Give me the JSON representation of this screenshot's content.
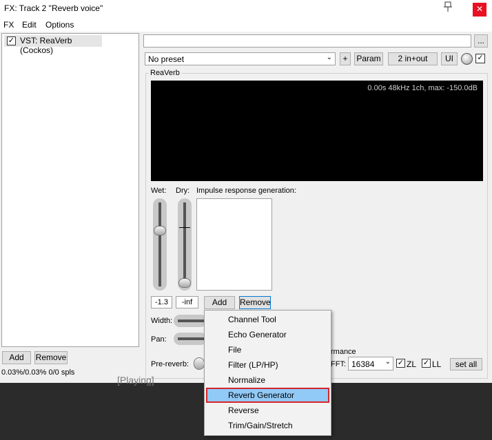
{
  "window": {
    "title": "FX: Track 2 \"Reverb voice\"",
    "close_icon": "✕"
  },
  "menu": [
    "FX",
    "Edit",
    "Options"
  ],
  "fx_chain": {
    "items": [
      {
        "label": "VST: ReaVerb (Cockos)",
        "enabled": true
      }
    ],
    "add_label": "Add",
    "remove_label": "Remove",
    "status": "0.03%/0.03% 0/0 spls"
  },
  "toolbar": {
    "preset_value": "No preset",
    "browse_label": "...",
    "plus_label": "+",
    "param_label": "Param",
    "io_label": "2 in+out",
    "ui_label": "UI"
  },
  "plugin": {
    "name": "ReaVerb",
    "display_text": "0.00s 48kHz 1ch, max: -150.0dB",
    "wet_label": "Wet:",
    "dry_label": "Dry:",
    "ir_label": "Impulse response generation:",
    "wet_value": "-1.3",
    "dry_value": "-inf",
    "add_label": "Add",
    "remove_label": "Remove",
    "width_label": "Width:",
    "pan_label": "Pan:",
    "prereverb_label": "Pre-reverb:",
    "perf_label": "rmance",
    "fft_label": "FFT:",
    "fft_value": "16384",
    "zl_label": "ZL",
    "ll_label": "LL",
    "setall_label": "set all"
  },
  "popup": {
    "items": [
      "Channel Tool",
      "Echo Generator",
      "File",
      "Filter (LP/HP)",
      "Normalize",
      "Reverb Generator",
      "Reverse",
      "Trim/Gain/Stretch"
    ],
    "selected": "Reverb Generator"
  },
  "background": {
    "playing_text": "[Playing]"
  }
}
